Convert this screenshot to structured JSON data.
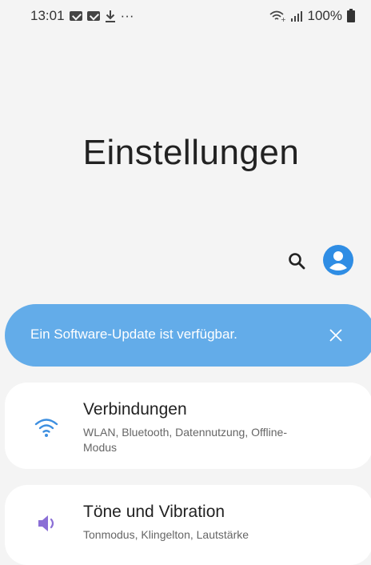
{
  "status_bar": {
    "time": "13:01",
    "extra": "···",
    "battery": "100%"
  },
  "page_title": "Einstellungen",
  "update_banner": {
    "text": "Ein Software-Update ist verfügbar."
  },
  "settings_items": [
    {
      "title": "Verbindungen",
      "subtitle": "WLAN, Bluetooth, Datennutzung, Offline-Modus",
      "icon": "wifi-icon",
      "icon_color": "#3d8fe0"
    },
    {
      "title": "Töne und Vibration",
      "subtitle": "Tonmodus, Klingelton, Lautstärke",
      "icon": "speaker-icon",
      "icon_color": "#8b6fd6"
    }
  ],
  "colors": {
    "background": "#f4f4f4",
    "banner": "#63ace9",
    "profile_accent": "#2f8de4"
  }
}
